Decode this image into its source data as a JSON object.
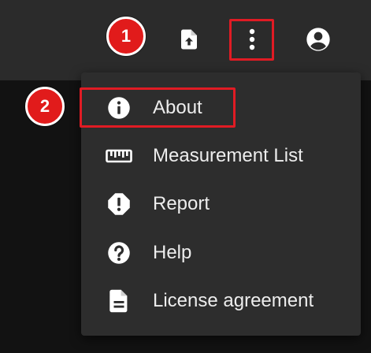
{
  "toolbar": {
    "icons": [
      "upload-file-icon",
      "more-vert-icon",
      "account-circle-icon"
    ]
  },
  "steps": {
    "step1": "1",
    "step2": "2"
  },
  "menu": {
    "items": [
      {
        "label": "About",
        "icon": "info-icon"
      },
      {
        "label": "Measurement List",
        "icon": "ruler-icon"
      },
      {
        "label": "Report",
        "icon": "report-icon"
      },
      {
        "label": "Help",
        "icon": "help-icon"
      },
      {
        "label": "License agreement",
        "icon": "document-icon"
      }
    ]
  },
  "colors": {
    "toolbar_bg": "#2b2b2b",
    "menu_bg": "#2d2d2d",
    "background": "#121212",
    "highlight": "#e01b24",
    "badge": "#e11b1b"
  }
}
